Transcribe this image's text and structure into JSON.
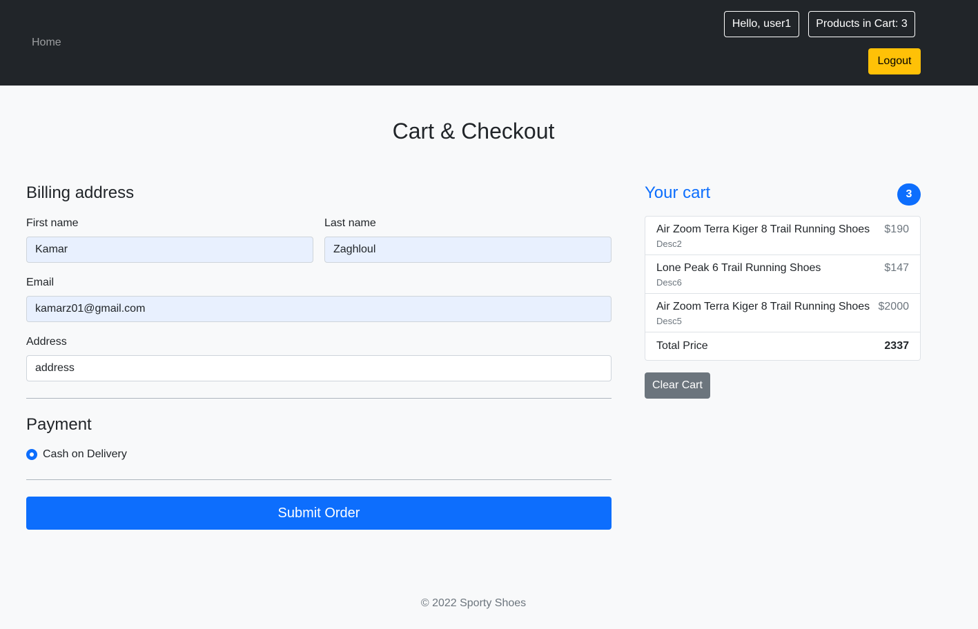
{
  "nav": {
    "home": "Home",
    "greeting": "Hello, user1",
    "cart_count": "Products in Cart: 3",
    "logout": "Logout"
  },
  "page": {
    "title": "Cart & Checkout"
  },
  "billing": {
    "heading": "Billing address",
    "first_name_label": "First name",
    "first_name_value": "Kamar",
    "last_name_label": "Last name",
    "last_name_value": "Zaghloul",
    "email_label": "Email",
    "email_value": "kamarz01@gmail.com",
    "address_label": "Address",
    "address_value": "address"
  },
  "payment": {
    "heading": "Payment",
    "option": "Cash on Delivery",
    "submit": "Submit Order"
  },
  "cart": {
    "title": "Your cart",
    "badge": "3",
    "items": [
      {
        "name": "Air Zoom Terra Kiger 8 Trail Running Shoes",
        "desc": "Desc2",
        "price": "$190"
      },
      {
        "name": "Lone Peak 6 Trail Running Shoes",
        "desc": "Desc6",
        "price": "$147"
      },
      {
        "name": "Air Zoom Terra Kiger 8 Trail Running Shoes",
        "desc": "Desc5",
        "price": "$2000"
      }
    ],
    "total_label": "Total Price",
    "total_value": "2337",
    "clear": "Clear Cart"
  },
  "footer": {
    "text": "© 2022 Sporty Shoes"
  },
  "colors": {
    "primary": "#0d6efd",
    "warning": "#ffc107",
    "dark": "#212529",
    "secondary": "#6c757d"
  }
}
